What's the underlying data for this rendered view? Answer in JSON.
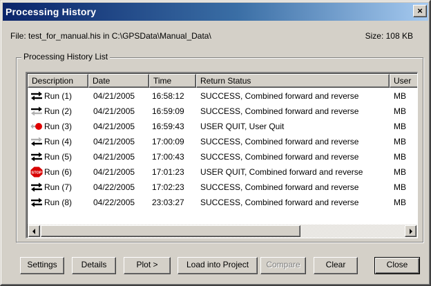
{
  "window": {
    "title": "Processing History",
    "close_glyph": "×"
  },
  "file_info": {
    "text": "File: test_for_manual.his in C:\\GPSData\\Manual_Data\\",
    "size": "Size: 108 KB"
  },
  "group": {
    "label": "Processing History List"
  },
  "table": {
    "columns": [
      "Description",
      "Date",
      "Time",
      "Return Status",
      "User"
    ],
    "rows": [
      {
        "icon": "bidirectional-arrows-icon",
        "description": "Run (1)",
        "date": "04/21/2005",
        "time": "16:58:12",
        "status": "SUCCESS, Combined forward and reverse",
        "user": "MB"
      },
      {
        "icon": "forward-arrow-icon",
        "description": "Run (2)",
        "date": "04/21/2005",
        "time": "16:59:09",
        "status": "SUCCESS, Combined forward and reverse",
        "user": "MB"
      },
      {
        "icon": "user-quit-red-dot-icon",
        "description": "Run (3)",
        "date": "04/21/2005",
        "time": "16:59:43",
        "status": "USER QUIT, User Quit",
        "user": "MB"
      },
      {
        "icon": "reverse-arrow-icon",
        "description": "Run (4)",
        "date": "04/21/2005",
        "time": "17:00:09",
        "status": "SUCCESS, Combined forward and reverse",
        "user": "MB"
      },
      {
        "icon": "bidirectional-arrows-icon",
        "description": "Run (5)",
        "date": "04/21/2005",
        "time": "17:00:43",
        "status": "SUCCESS, Combined forward and reverse",
        "user": "MB"
      },
      {
        "icon": "stop-sign-icon",
        "description": "Run (6)",
        "date": "04/21/2005",
        "time": "17:01:23",
        "status": "USER QUIT, Combined forward and reverse",
        "user": "MB"
      },
      {
        "icon": "bidirectional-arrows-icon",
        "description": "Run (7)",
        "date": "04/22/2005",
        "time": "17:02:23",
        "status": "SUCCESS, Combined forward and reverse",
        "user": "MB"
      },
      {
        "icon": "bidirectional-arrows-icon",
        "description": "Run (8)",
        "date": "04/22/2005",
        "time": "23:03:27",
        "status": "SUCCESS, Combined forward and reverse",
        "user": "MB"
      }
    ],
    "stop_icon_text": "STOP"
  },
  "buttons": {
    "settings": "Settings",
    "details": "Details",
    "plot": "Plot  >",
    "load": "Load into Project",
    "compare": "Compare",
    "clear": "Clear",
    "close": "Close"
  }
}
